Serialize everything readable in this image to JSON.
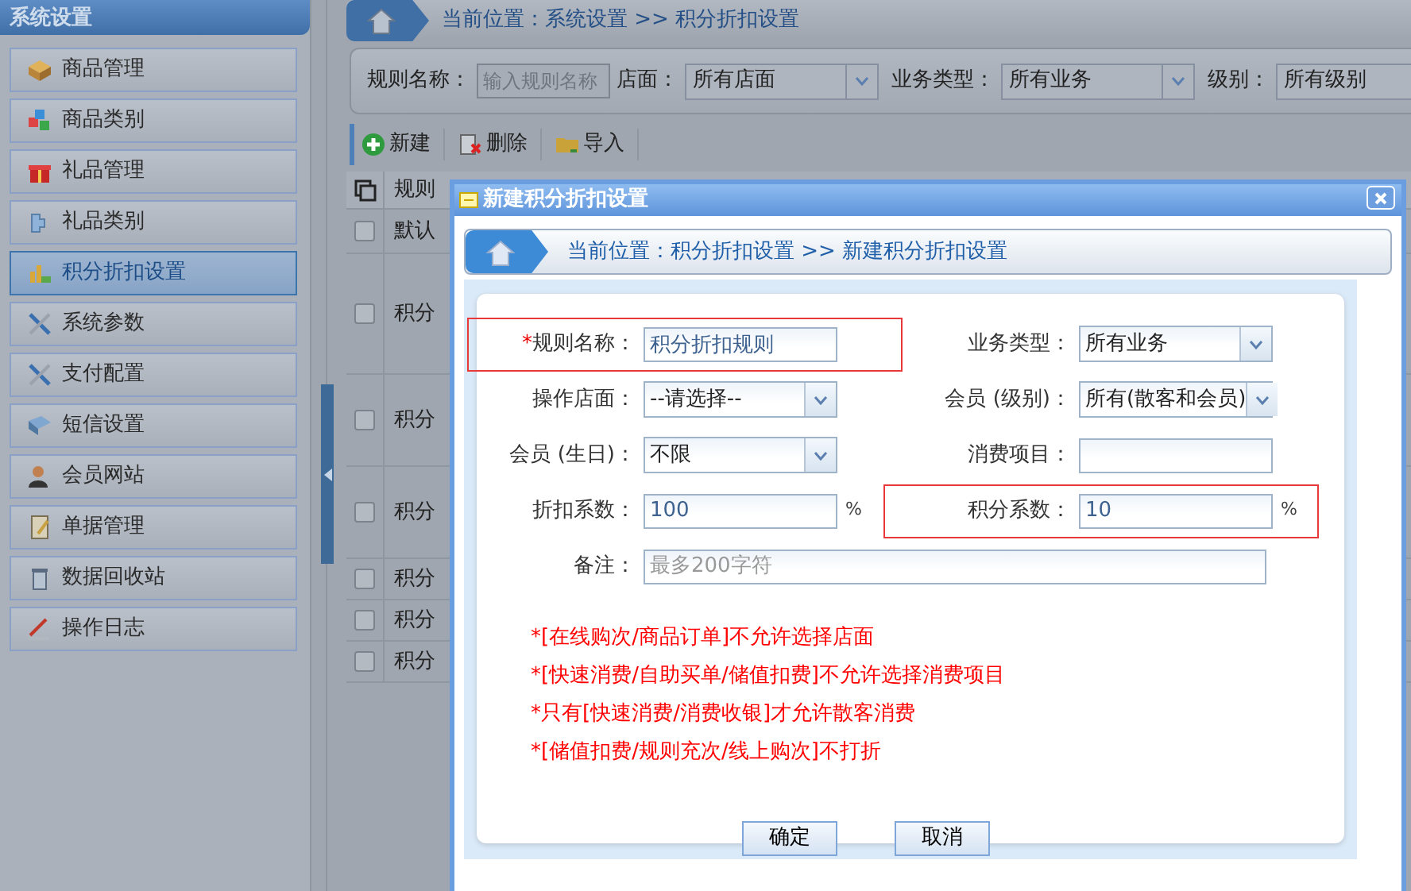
{
  "sidebar": {
    "title": "系统设置",
    "items": [
      {
        "label": "商品管理",
        "selected": false
      },
      {
        "label": "商品类别",
        "selected": false
      },
      {
        "label": "礼品管理",
        "selected": false
      },
      {
        "label": "礼品类别",
        "selected": false
      },
      {
        "label": "积分折扣设置",
        "selected": true
      },
      {
        "label": "系统参数",
        "selected": false
      },
      {
        "label": "支付配置",
        "selected": false
      },
      {
        "label": "短信设置",
        "selected": false
      },
      {
        "label": "会员网站",
        "selected": false
      },
      {
        "label": "单据管理",
        "selected": false
      },
      {
        "label": "数据回收站",
        "selected": false
      },
      {
        "label": "操作日志",
        "selected": false
      }
    ]
  },
  "breadcrumb": "当前位置：系统设置 >> 积分折扣设置",
  "filters": [
    {
      "kind": "text",
      "label": "规则名称：",
      "placeholder": "输入规则名称"
    },
    {
      "kind": "select",
      "label": "店面：",
      "value": "所有店面"
    },
    {
      "kind": "select",
      "label": "业务类型：",
      "value": "所有业务"
    },
    {
      "kind": "select",
      "label": "级别：",
      "value": "所有级别"
    }
  ],
  "toolbar": [
    {
      "kind": "add",
      "label": "新建"
    },
    {
      "kind": "delete",
      "label": "删除"
    },
    {
      "kind": "import",
      "label": "导入"
    }
  ],
  "table": {
    "columns": [
      "规则"
    ],
    "rows": [
      {
        "checked": false,
        "column_1": "默认"
      },
      {
        "checked": false,
        "column_1": "积分"
      },
      {
        "checked": false,
        "column_1": "积分"
      },
      {
        "checked": false,
        "column_1": "积分"
      },
      {
        "checked": false,
        "column_1": "积分"
      },
      {
        "checked": false,
        "column_1": "积分"
      },
      {
        "checked": false,
        "column_1": "积分"
      }
    ]
  },
  "dialog": {
    "title": "新建积分折扣设置",
    "breadcrumb": "当前位置：积分折扣设置 >> 新建积分折扣设置",
    "fields": [
      {
        "kind": "text",
        "required_mark": "*",
        "label": "规则名称：",
        "value": "积分折扣规则",
        "highlighted": true
      },
      {
        "kind": "select",
        "label": "业务类型：",
        "value": "所有业务",
        "highlighted": false
      },
      {
        "kind": "select",
        "label": "操作店面：",
        "value": "--请选择--",
        "highlighted": false
      },
      {
        "kind": "select",
        "label": "会员 (级别)：",
        "value": "所有(散客和会员)",
        "highlighted": false
      },
      {
        "kind": "select",
        "label": "会员 (生日)：",
        "value": "不限",
        "highlighted": false
      },
      {
        "kind": "text",
        "label": "消费项目：",
        "highlighted": false
      },
      {
        "kind": "text",
        "label": "折扣系数：",
        "value": "100",
        "unit": "%",
        "highlighted": false
      },
      {
        "kind": "text",
        "label": "积分系数：",
        "value": "10",
        "unit": "%",
        "highlighted": true
      }
    ],
    "remark": {
      "label": "备注：",
      "placeholder": "最多200字符"
    },
    "notes": [
      "*[在线购次/商品订单]不允许选择店面",
      "*[快速消费/自助买单/储值扣费]不允许选择消费项目",
      "*只有[快速消费/消费收银]才允许散客消费",
      "*[储值扣费/规则充次/线上购次]不打折"
    ],
    "buttons": [
      "确定",
      "取消"
    ]
  }
}
